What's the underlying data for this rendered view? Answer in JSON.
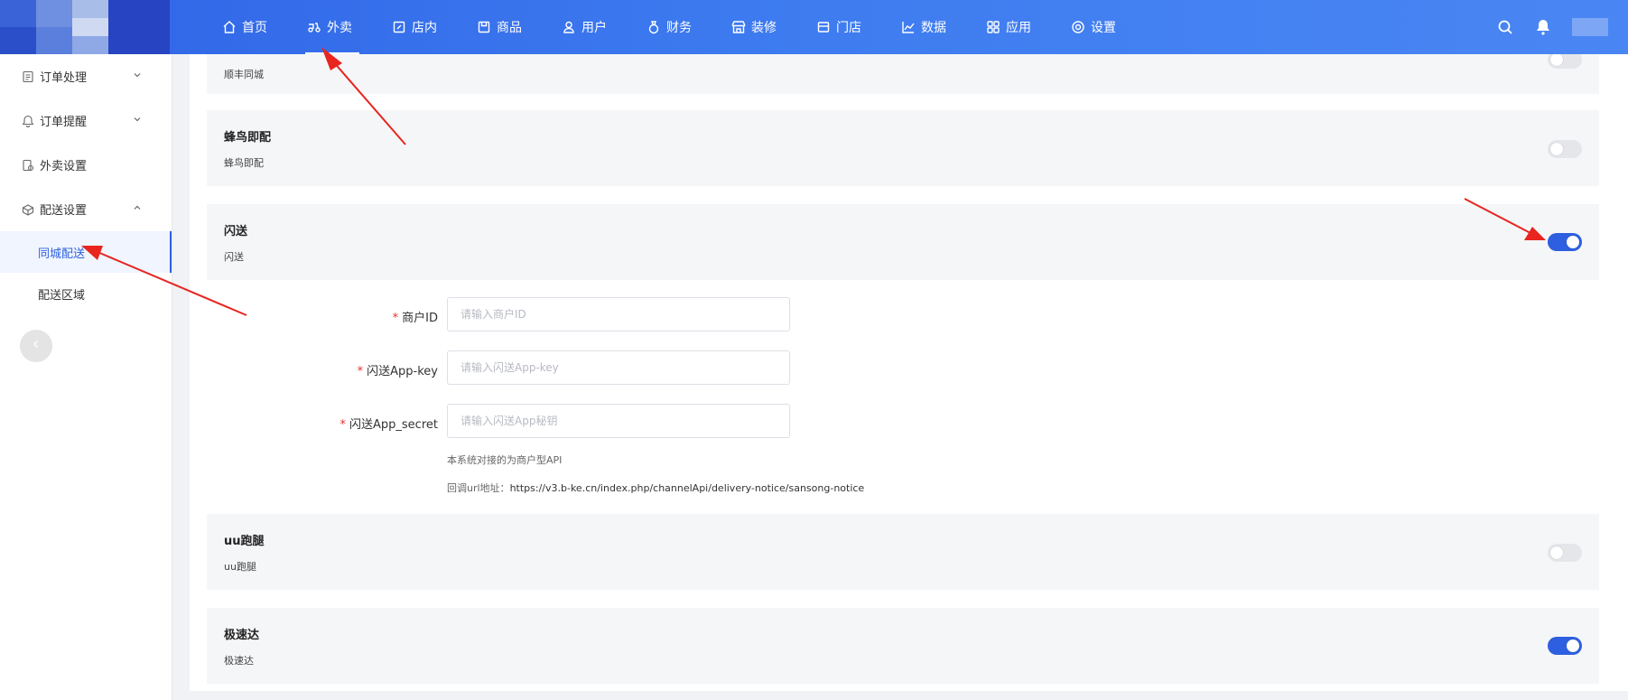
{
  "nav": {
    "items": [
      {
        "label": "首页",
        "icon": "home-icon"
      },
      {
        "label": "外卖",
        "icon": "scooter-icon"
      },
      {
        "label": "店内",
        "icon": "edit-icon"
      },
      {
        "label": "商品",
        "icon": "product-icon"
      },
      {
        "label": "用户",
        "icon": "user-icon"
      },
      {
        "label": "财务",
        "icon": "money-bag-icon"
      },
      {
        "label": "装修",
        "icon": "storefront-icon"
      },
      {
        "label": "门店",
        "icon": "store-icon"
      },
      {
        "label": "数据",
        "icon": "chart-icon"
      },
      {
        "label": "应用",
        "icon": "apps-icon"
      },
      {
        "label": "设置",
        "icon": "gear-icon"
      }
    ],
    "active_index": 1
  },
  "sidebar": {
    "items": [
      {
        "label": "订单处理",
        "icon": "document-icon",
        "chevron": "down"
      },
      {
        "label": "订单提醒",
        "icon": "bell-icon",
        "chevron": "down"
      },
      {
        "label": "外卖设置",
        "icon": "settings-doc-icon",
        "chevron": ""
      },
      {
        "label": "配送设置",
        "icon": "delivery-box-icon",
        "chevron": "up"
      }
    ],
    "subitems": [
      {
        "label": "同城配送",
        "active": true
      },
      {
        "label": "配送区域",
        "active": false
      }
    ]
  },
  "providers": [
    {
      "title": "",
      "subtitle": "顺丰同城",
      "enabled": false
    },
    {
      "title": "蜂鸟即配",
      "subtitle": "蜂鸟即配",
      "enabled": false
    },
    {
      "title": "闪送",
      "subtitle": "闪送",
      "enabled": true
    },
    {
      "title": "uu跑腿",
      "subtitle": "uu跑腿",
      "enabled": false
    },
    {
      "title": "极速达",
      "subtitle": "极速达",
      "enabled": true
    }
  ],
  "form": {
    "required_mark": "*",
    "fields": [
      {
        "label": "商户ID",
        "placeholder": "请输入商户ID",
        "value": ""
      },
      {
        "label": "闪送App-key",
        "placeholder": "请输入闪送App-key",
        "value": ""
      },
      {
        "label": "闪送App_secret",
        "placeholder": "请输入闪送App秘钥",
        "value": ""
      }
    ],
    "hint1": "本系统对接的为商户型API",
    "hint2_label": "回调url地址：",
    "hint2_url": "https://v3.b-ke.cn/index.php/channelApi/delivery-notice/sansong-notice"
  },
  "colors": {
    "primary": "#2d5fe0",
    "annotation_arrow": "#e8251f"
  }
}
